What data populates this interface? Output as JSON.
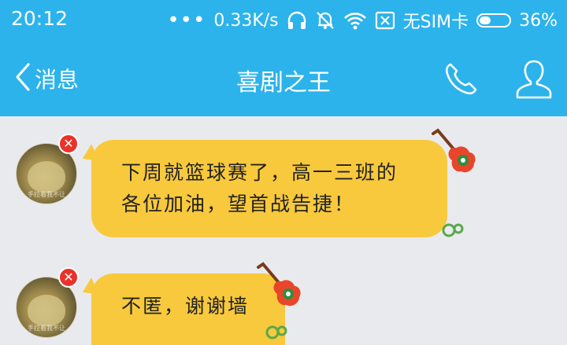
{
  "status_bar": {
    "time": "20:12",
    "network_speed": "0.33K/s",
    "sim_status": "无SIM卡",
    "battery": "36%"
  },
  "nav": {
    "back_label": "消息",
    "title": "喜剧之王"
  },
  "messages": [
    {
      "lines": [
        "下周就篮球赛了，高一三班的",
        "各位加油，望首战告捷！"
      ]
    },
    {
      "lines": [
        "不匿，谢谢墙"
      ]
    }
  ],
  "avatar_caption": "手拉着我不让",
  "colors": {
    "header": "#2cb3eb",
    "bubble": "#f8c93c",
    "background": "#e9eaee",
    "badge": "#e8322a"
  }
}
